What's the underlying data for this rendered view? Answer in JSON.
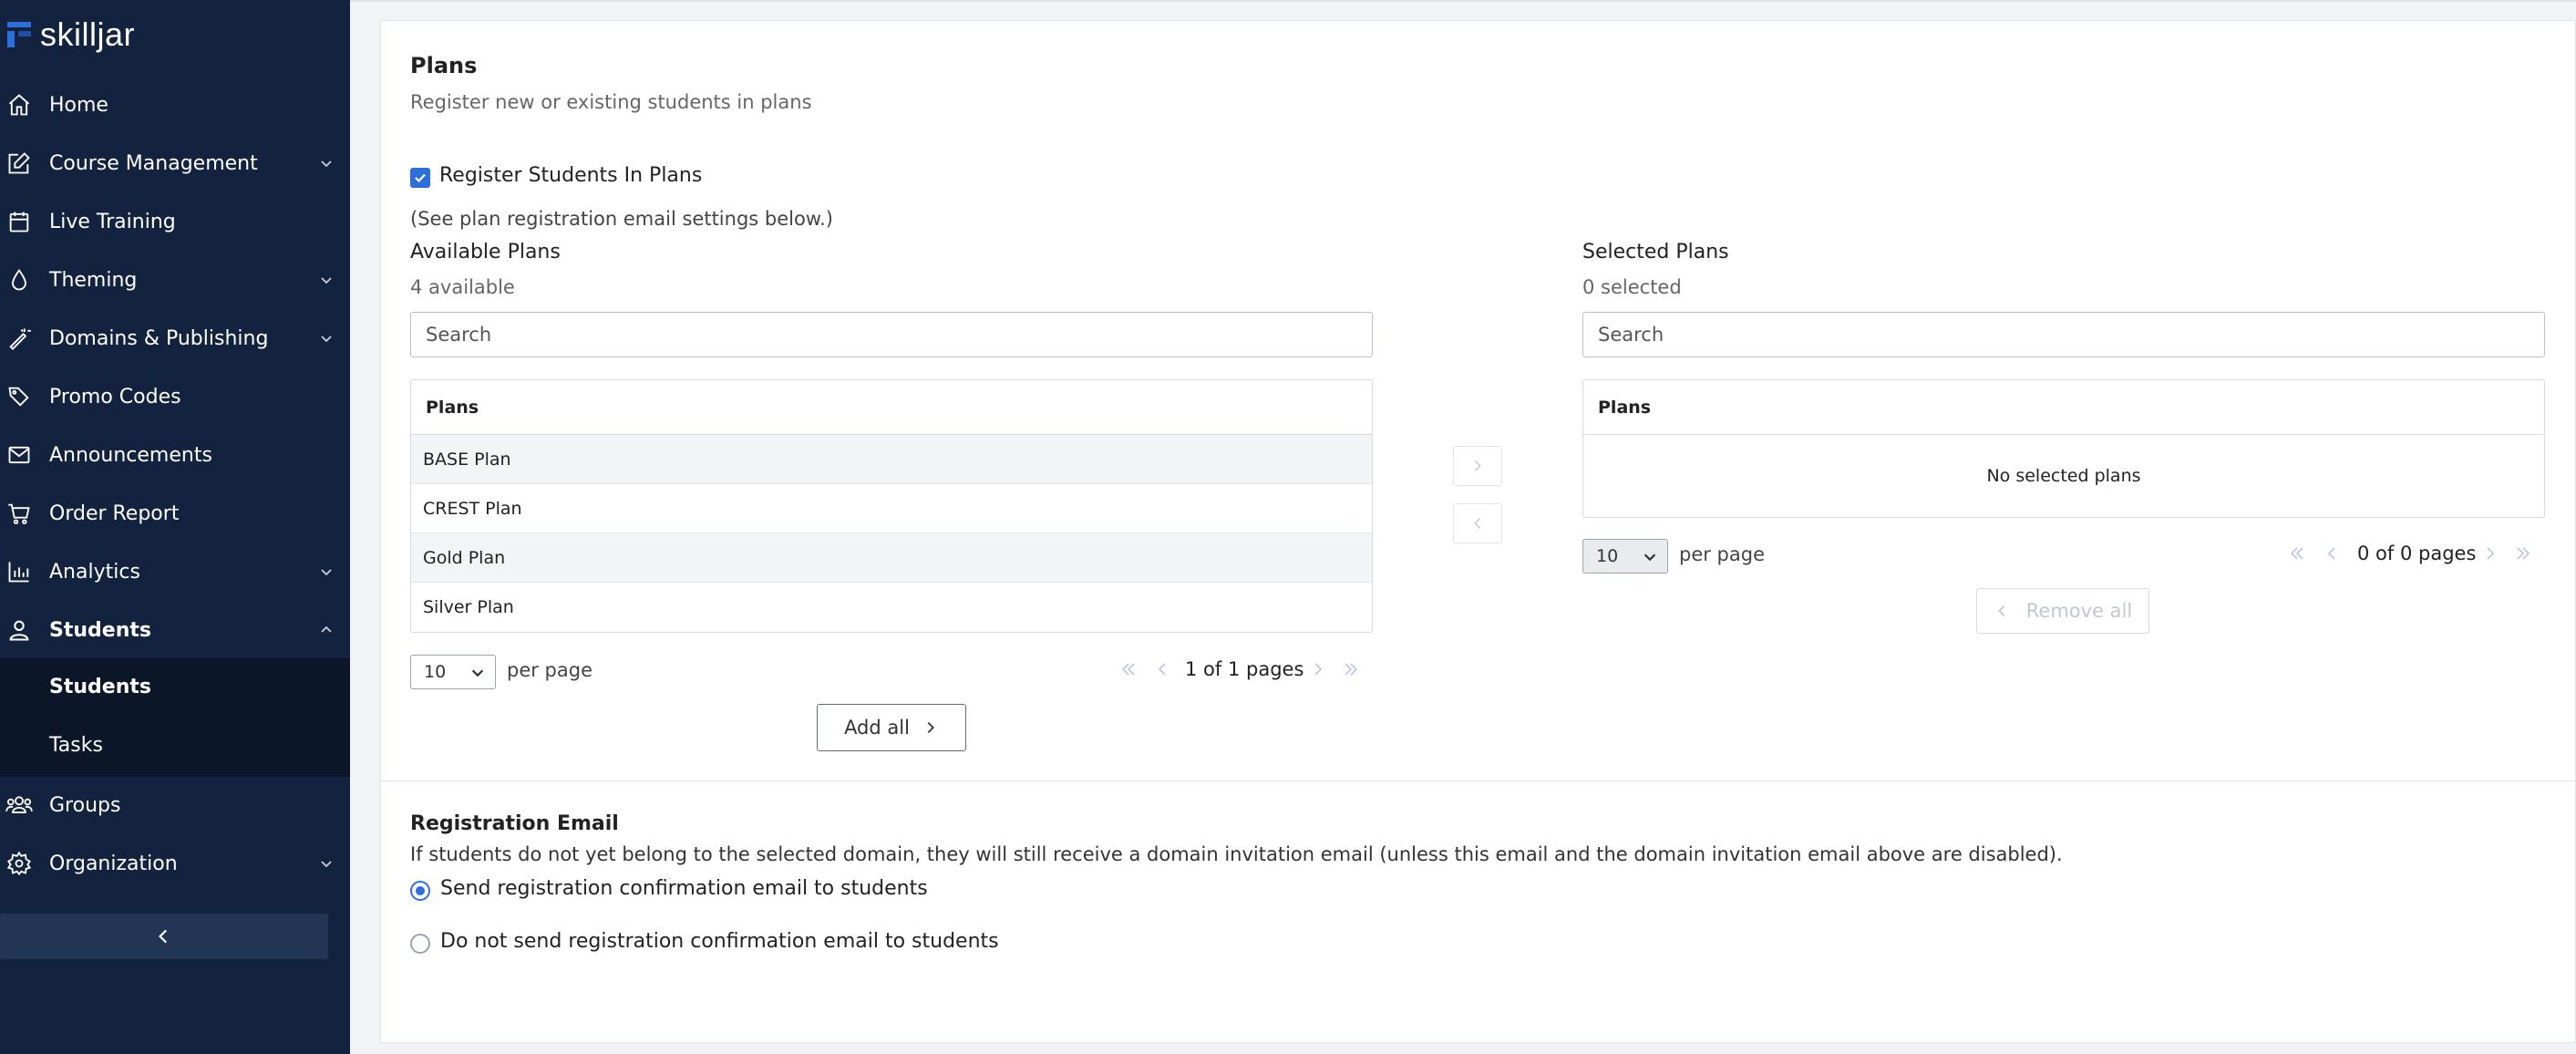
{
  "brand": {
    "logo_text": "skilljar",
    "accent": "#2f6fdc",
    "sidebar_bg": "#13233f"
  },
  "sidebar": {
    "items": [
      {
        "label": "Home",
        "icon": "home-icon",
        "has_chevron": false
      },
      {
        "label": "Course Management",
        "icon": "edit-icon",
        "has_chevron": true
      },
      {
        "label": "Live Training",
        "icon": "calendar-icon",
        "has_chevron": false
      },
      {
        "label": "Theming",
        "icon": "droplet-icon",
        "has_chevron": true
      },
      {
        "label": "Domains & Publishing",
        "icon": "magic-wand-icon",
        "has_chevron": true
      },
      {
        "label": "Promo Codes",
        "icon": "tags-icon",
        "has_chevron": false
      },
      {
        "label": "Announcements",
        "icon": "envelope-icon",
        "has_chevron": false
      },
      {
        "label": "Order Report",
        "icon": "cart-icon",
        "has_chevron": false
      },
      {
        "label": "Analytics",
        "icon": "bar-chart-icon",
        "has_chevron": true
      },
      {
        "label": "Students",
        "icon": "user-icon",
        "has_chevron": true,
        "expanded": true
      },
      {
        "label": "Groups",
        "icon": "users-icon",
        "has_chevron": false
      },
      {
        "label": "Organization",
        "icon": "gear-icon",
        "has_chevron": true
      }
    ],
    "sub_items": [
      {
        "label": "Students",
        "active": true
      },
      {
        "label": "Tasks",
        "active": false
      }
    ]
  },
  "plans": {
    "title": "Plans",
    "subtitle": "Register new or existing students in plans",
    "register_checkbox_label": "Register Students In Plans",
    "register_checked": true,
    "note": "(See plan registration email settings below.)",
    "available": {
      "title": "Available Plans",
      "count": "4 available",
      "search_placeholder": "Search",
      "column": "Plans",
      "rows": [
        "BASE Plan",
        "CREST Plan",
        "Gold Plan",
        "Silver Plan"
      ],
      "per_page": "10",
      "per_page_label": "per page",
      "pager": "1 of 1 pages",
      "add_all": "Add all"
    },
    "selected": {
      "title": "Selected Plans",
      "count": "0 selected",
      "search_placeholder": "Search",
      "column": "Plans",
      "empty": "No selected plans",
      "per_page": "10",
      "per_page_label": "per page",
      "pager": "0 of 0 pages",
      "remove_all": "Remove all"
    }
  },
  "registration_email": {
    "title": "Registration Email",
    "description": "If students do not yet belong to the selected domain, they will still receive a domain invitation email (unless this email and the domain invitation email above are disabled).",
    "options": [
      {
        "label": "Send registration confirmation email to students",
        "selected": true
      },
      {
        "label": "Do not send registration confirmation email to students",
        "selected": false
      }
    ]
  }
}
